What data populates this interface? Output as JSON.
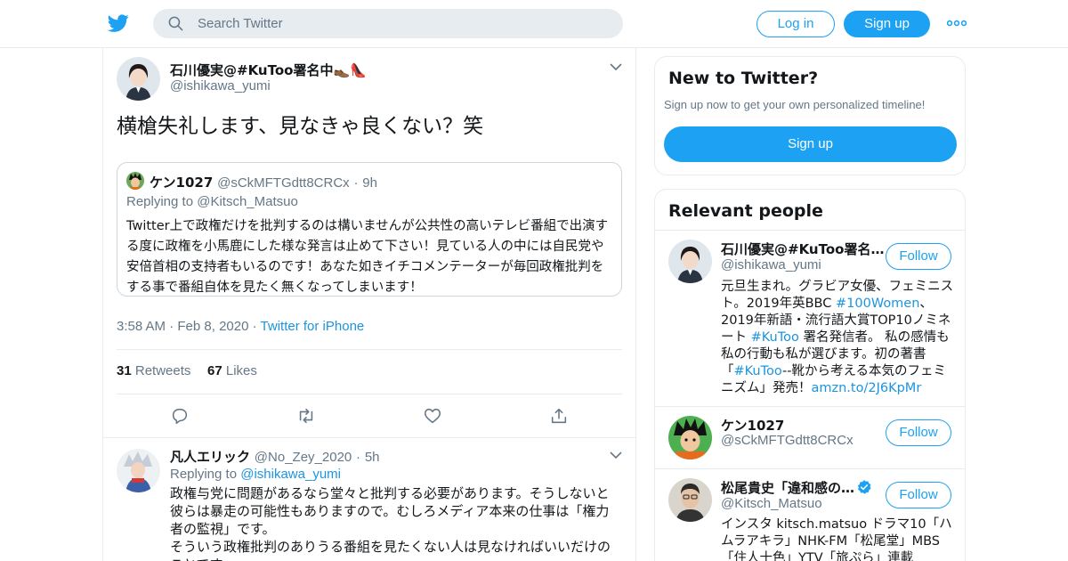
{
  "header": {
    "logo_icon": "twitter-bird-icon",
    "search_placeholder": "Search Twitter",
    "login_label": "Log in",
    "signup_label": "Sign up",
    "more_icon": "more-dots-icon"
  },
  "colors": {
    "accent": "#1da1f2",
    "link": "#1b95e0",
    "muted": "#657786",
    "border": "#e6ecf0"
  },
  "tweet": {
    "display_name": "石川優実@#KuToo署名中👞👠",
    "handle": "@ishikawa_yumi",
    "text": "横槍失礼します、見なきゃ良くない？笑",
    "quoted": {
      "display_name": "ケン1027",
      "handle": "@sCkMFTGdtt8CRCx",
      "sep": "·",
      "time": "9h",
      "replying_prefix": "Replying to",
      "replying_to": "@Kitsch_Matsuo",
      "text": "Twitter上で政権だけを批判するのは構いませんが公共性の高いテレビ番組で出演する度に政権を小馬鹿にした様な発言は止めて下さい！見ている人の中には自民党や安倍首相の支持者もいるのです！あなた如きイチコメンテーターが毎回政権批判をする事で番組自体を見たく無くなってしまいます！"
    },
    "time": "3:58 AM",
    "date": "Feb 8, 2020",
    "sep": "·",
    "source": "Twitter for iPhone",
    "retweets_count": "31",
    "retweets_label": "Retweets",
    "likes_count": "67",
    "likes_label": "Likes"
  },
  "reply": {
    "display_name": "凡人エリック",
    "handle": "@No_Zey_2020",
    "sep": "·",
    "time": "5h",
    "replying_prefix": "Replying to",
    "replying_to": "@ishikawa_yumi",
    "text_line1": "政権与党に問題があるなら堂々と批判する必要があります。そうしないと彼らは暴走の可能性もありますので。むしろメディア本来の仕事は「権力者の監視」です。",
    "text_line2": "そういう政権批判のありうる番組を見たくない人は見なければいいだけのことです。"
  },
  "new_to_twitter": {
    "title": "New to Twitter?",
    "subtitle": "Sign up now to get your own personalized timeline!",
    "button": "Sign up"
  },
  "relevant": {
    "title": "Relevant people",
    "follow_label": "Follow",
    "people": [
      {
        "name": "石川優実@#KuToo署名…",
        "handle": "@ishikawa_yumi",
        "bio_1": "元旦生まれ。グラビア女優、フェミニスト。2019年英BBC ",
        "bio_tag1": "#100Women",
        "bio_2": "、2019年新語・流行語大賞TOP10ノミネート ",
        "bio_tag2": "#KuToo",
        "bio_3": " 署名発信者。 私の感情も私の行動も私が選びます。初の著書「",
        "bio_tag3": "#KuToo",
        "bio_4": "--靴から考える本気のフェミニズム」発売！",
        "bio_link": "amzn.to/2J6KpMr"
      },
      {
        "name": "ケン1027",
        "handle": "@sCkMFTGdtt8CRCx"
      },
      {
        "name": "松尾貴史「違和感の…",
        "handle": "@Kitsch_Matsuo",
        "verified": true,
        "bio": "インスタ kitsch.matsuo ドラマ10「ハムラアキラ」NHK-FM「松尾堂」MBS「住人十色」YTV「旅ぷら」連載"
      }
    ]
  }
}
